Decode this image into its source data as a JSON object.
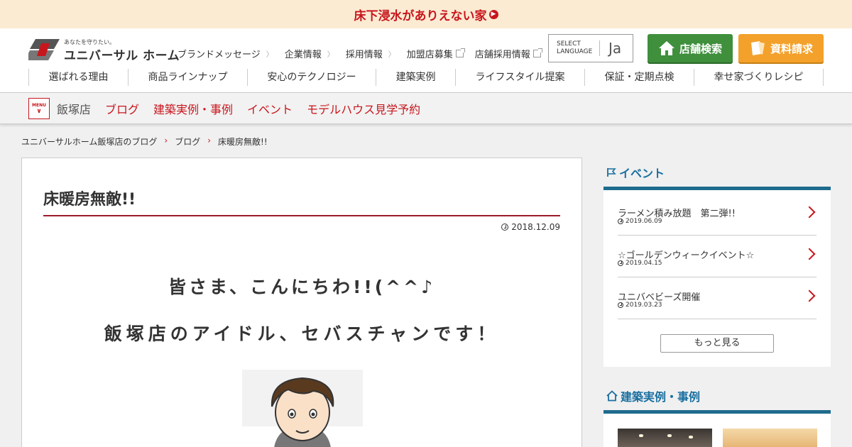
{
  "banner": {
    "text": "床下浸水がありえない家"
  },
  "logo": {
    "tagline": "あなたを守りたい。",
    "name": "ユニバーサル ホーム"
  },
  "util_nav": [
    {
      "label": "ブランドメッセージ",
      "type": "chevron"
    },
    {
      "label": "企業情報",
      "type": "chevron"
    },
    {
      "label": "採用情報",
      "type": "chevron"
    },
    {
      "label": "加盟店募集",
      "type": "external"
    },
    {
      "label": "店舗採用情報",
      "type": "external"
    }
  ],
  "language": {
    "label_line1": "SELECT",
    "label_line2": "LANGUAGE",
    "value": "Ja"
  },
  "buttons": {
    "shop_search": "店舗検索",
    "request_docs": "資料請求"
  },
  "main_nav": [
    "選ばれる理由",
    "商品ラインナップ",
    "安心のテクノロジー",
    "建築実例",
    "ライフスタイル提案",
    "保証・定期点検",
    "幸せ家づくりレシピ"
  ],
  "subnav": {
    "menu_label": "MENU",
    "store": "飯塚店",
    "links": [
      "ブログ",
      "建築実例・事例",
      "イベント",
      "モデルハウス見学予約"
    ]
  },
  "breadcrumb": [
    "ユニバーサルホーム飯塚店のブログ",
    "ブログ",
    "床暖房無敵!!"
  ],
  "article": {
    "title": "床暖房無敵!!",
    "date": "2018.12.09",
    "line1": "皆さま、こんにちわ!!(^^♪",
    "line2": "飯塚店のアイドル、セバスチャンです！"
  },
  "events": {
    "heading": "イベント",
    "items": [
      {
        "title": "ラーメン積み放題　第二弾!!",
        "date": "2019.06.09"
      },
      {
        "title": "☆ゴールデンウィークイベント☆",
        "date": "2019.04.15"
      },
      {
        "title": "ユニバベビーズ開催",
        "date": "2019.03.23"
      }
    ],
    "more": "もっと見る"
  },
  "works": {
    "heading": "建築実例・事例"
  },
  "colors": {
    "brand_red": "#c8161d",
    "shop_green": "#3f8f3c",
    "doc_orange": "#f3a12b",
    "side_blue": "#1f6b8e"
  }
}
